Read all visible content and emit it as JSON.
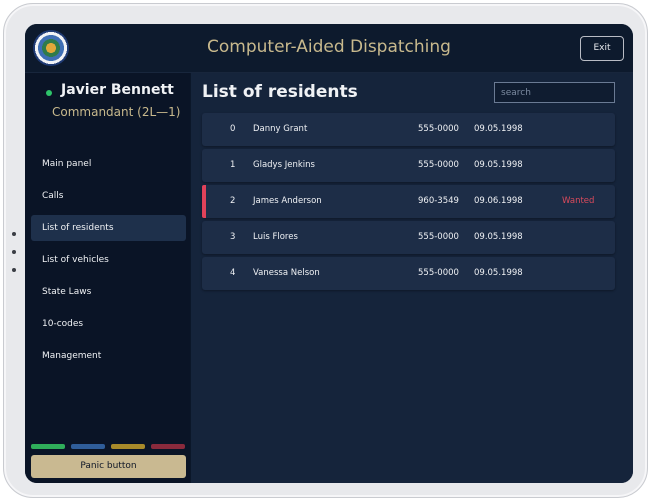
{
  "header": {
    "title": "Computer-Aided Dispatching",
    "exit_label": "Exit"
  },
  "user": {
    "name": "Javier Bennett",
    "rank": "Commandant (2L—1)",
    "status_color": "#2ec46a"
  },
  "sidebar": {
    "items": [
      {
        "label": "Main panel",
        "active": false
      },
      {
        "label": "Calls",
        "active": false
      },
      {
        "label": "List of residents",
        "active": true
      },
      {
        "label": "List of vehicles",
        "active": false
      },
      {
        "label": "State Laws",
        "active": false
      },
      {
        "label": "10-codes",
        "active": false
      },
      {
        "label": "Management",
        "active": false
      }
    ],
    "code_colors": [
      "#2fae5a",
      "#2f5d99",
      "#a88a2a",
      "#8a2a3c"
    ],
    "panic_label": "Panic button"
  },
  "main": {
    "title": "List of residents",
    "search": {
      "placeholder": "search",
      "value": ""
    },
    "residents": [
      {
        "id": "0",
        "name": "Danny Grant",
        "phone": "555-0000",
        "dob": "09.05.1998",
        "status": ""
      },
      {
        "id": "1",
        "name": "Gladys Jenkins",
        "phone": "555-0000",
        "dob": "09.05.1998",
        "status": ""
      },
      {
        "id": "2",
        "name": "James Anderson",
        "phone": "960-3549",
        "dob": "09.06.1998",
        "status": "Wanted"
      },
      {
        "id": "3",
        "name": "Luis Flores",
        "phone": "555-0000",
        "dob": "09.05.1998",
        "status": ""
      },
      {
        "id": "4",
        "name": "Vanessa Nelson",
        "phone": "555-0000",
        "dob": "09.05.1998",
        "status": ""
      }
    ]
  },
  "colors": {
    "accent": "#c8b98d",
    "wanted": "#e0425a",
    "background": "#15243b"
  }
}
